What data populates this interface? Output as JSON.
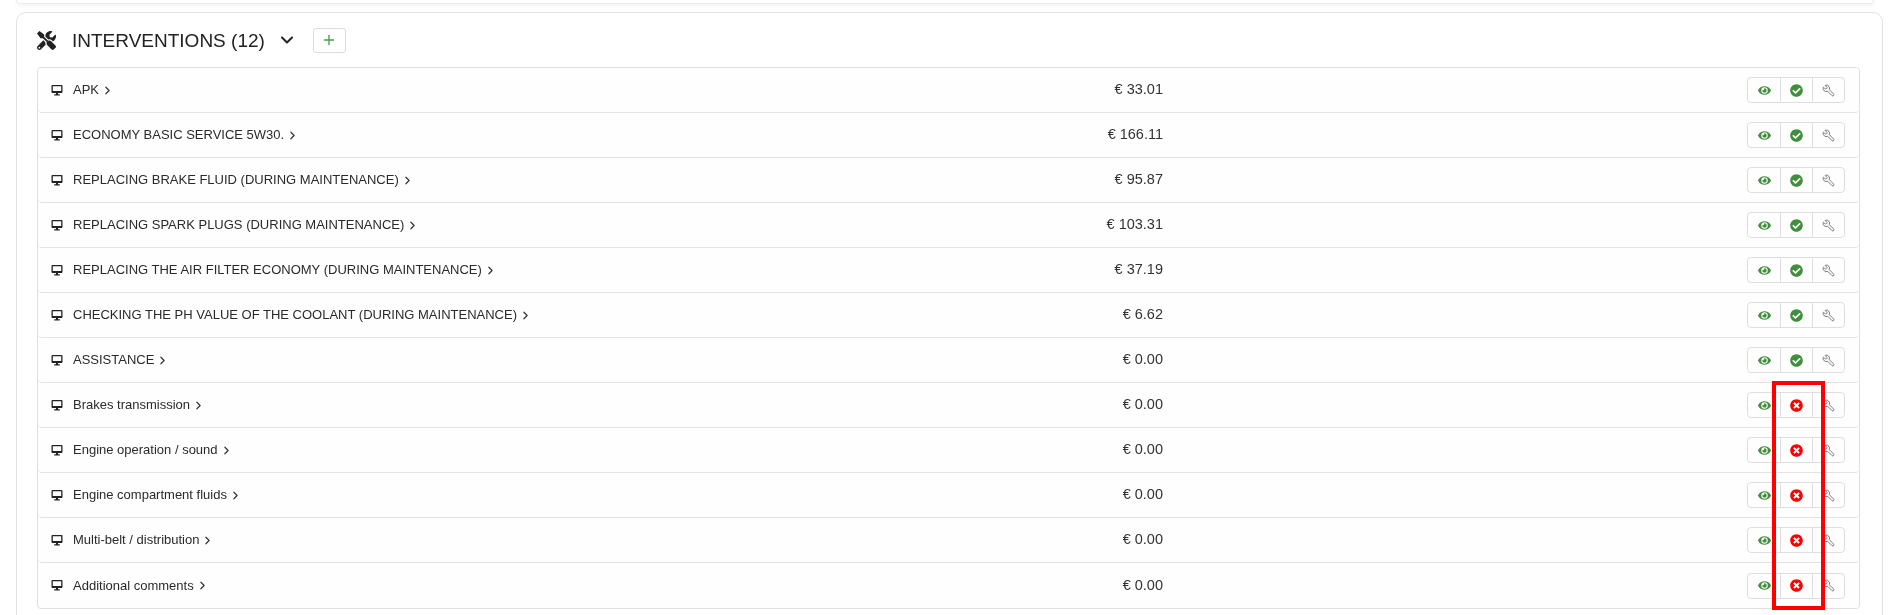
{
  "section": {
    "title": "INTERVENTIONS (12)",
    "expanded": true
  },
  "rows": [
    {
      "name": "APK",
      "price": "€ 33.01",
      "approved": true,
      "highlighted": false
    },
    {
      "name": "ECONOMY BASIC SERVICE 5W30.",
      "price": "€ 166.11",
      "approved": true,
      "highlighted": false
    },
    {
      "name": "REPLACING BRAKE FLUID (DURING MAINTENANCE)",
      "price": "€ 95.87",
      "approved": true,
      "highlighted": false
    },
    {
      "name": "REPLACING SPARK PLUGS (DURING MAINTENANCE)",
      "price": "€ 103.31",
      "approved": true,
      "highlighted": false
    },
    {
      "name": "REPLACING THE AIR FILTER ECONOMY (DURING MAINTENANCE)",
      "price": "€ 37.19",
      "approved": true,
      "highlighted": false
    },
    {
      "name": "CHECKING THE PH VALUE OF THE COOLANT (DURING MAINTENANCE)",
      "price": "€ 6.62",
      "approved": true,
      "highlighted": false
    },
    {
      "name": "ASSISTANCE",
      "price": "€ 0.00",
      "approved": true,
      "highlighted": false
    },
    {
      "name": "Brakes transmission",
      "price": "€ 0.00",
      "approved": false,
      "highlighted": true
    },
    {
      "name": "Engine operation / sound",
      "price": "€ 0.00",
      "approved": false,
      "highlighted": true
    },
    {
      "name": "Engine compartment fluids",
      "price": "€ 0.00",
      "approved": false,
      "highlighted": true
    },
    {
      "name": "Multi-belt / distribution",
      "price": "€ 0.00",
      "approved": false,
      "highlighted": true
    },
    {
      "name": "Additional comments",
      "price": "€ 0.00",
      "approved": false,
      "highlighted": true
    }
  ]
}
